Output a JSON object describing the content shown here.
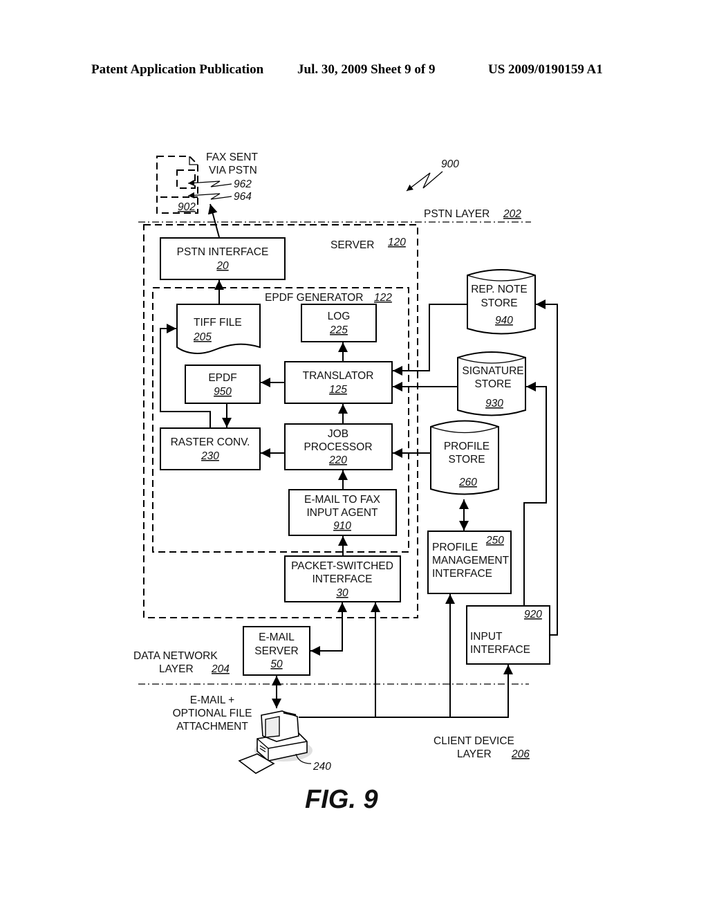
{
  "header": {
    "publication": "Patent Application Publication",
    "date_sheet": "Jul. 30, 2009   Sheet 9 of 9",
    "number": "US 2009/0190159 A1"
  },
  "figure": {
    "ref": "900",
    "caption": "FIG. 9"
  },
  "layers": {
    "pstn": {
      "line1": "PSTN LAYER",
      "ref": "202"
    },
    "data_network": {
      "line1": "DATA NETWORK",
      "line2": "LAYER",
      "ref": "204"
    },
    "client_device": {
      "line1": "CLIENT DEVICE",
      "line2": "LAYER",
      "ref": "206"
    }
  },
  "fax": {
    "line1": "FAX SENT",
    "line2": "VIA PSTN",
    "ref": "902",
    "sub_ref_a": "962",
    "sub_ref_b": "964"
  },
  "server": {
    "label": "SERVER",
    "ref": "120"
  },
  "epdf_generator": {
    "label": "EPDF GENERATOR",
    "ref": "122"
  },
  "blocks": {
    "pstn_interface": {
      "line1": "PSTN INTERFACE",
      "ref": "20"
    },
    "tiff_file": {
      "line1": "TIFF FILE",
      "ref": "205"
    },
    "log": {
      "line1": "LOG",
      "ref": "225"
    },
    "epdf": {
      "line1": "EPDF",
      "ref": "950"
    },
    "translator": {
      "line1": "TRANSLATOR",
      "ref": "125"
    },
    "raster_conv": {
      "line1": "RASTER CONV.",
      "ref": "230"
    },
    "job_processor": {
      "line1": "JOB",
      "line2": "PROCESSOR",
      "ref": "220"
    },
    "email_agent": {
      "line1": "E-MAIL TO FAX",
      "line2": "INPUT AGENT",
      "ref": "910"
    },
    "packet_interface": {
      "line1": "PACKET-SWITCHED",
      "line2": "INTERFACE",
      "ref": "30"
    },
    "email_server": {
      "line1": "E-MAIL",
      "line2": "SERVER",
      "ref": "50"
    },
    "profile_mgmt": {
      "line1": "PROFILE",
      "line2": "MANAGEMENT",
      "line3": "INTERFACE",
      "ref": "250"
    },
    "input_interface": {
      "line1": "INPUT",
      "line2": "INTERFACE",
      "ref": "920"
    }
  },
  "stores": {
    "rep_note": {
      "line1": "REP. NOTE",
      "line2": "STORE",
      "ref": "940"
    },
    "signature": {
      "line1": "SIGNATURE",
      "line2": "STORE",
      "ref": "930"
    },
    "profile": {
      "line1": "PROFILE",
      "line2": "STORE",
      "ref": "260"
    }
  },
  "client": {
    "note_line1": "E-MAIL +",
    "note_line2": "OPTIONAL FILE",
    "note_line3": "ATTACHMENT",
    "ref": "240"
  }
}
